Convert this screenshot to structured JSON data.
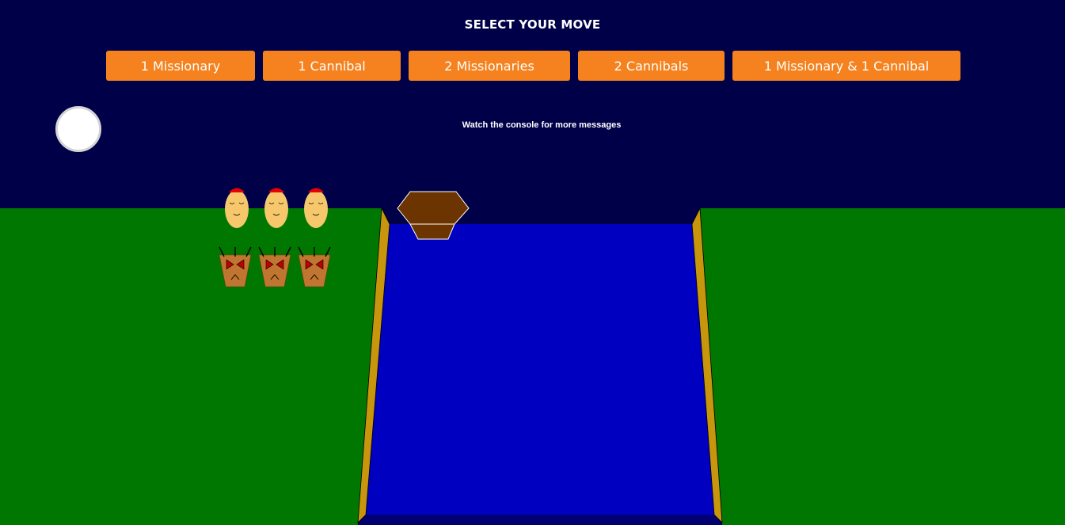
{
  "header": {
    "title": "SELECT YOUR MOVE",
    "buttons": [
      {
        "label": "1 Missionary"
      },
      {
        "label": "1 Cannibal"
      },
      {
        "label": "2 Missionaries"
      },
      {
        "label": "2 Cannibals"
      },
      {
        "label": "1 Missionary & 1 Cannibal"
      }
    ]
  },
  "console_message": "Watch the console for more messages",
  "game_state": {
    "left_bank": {
      "missionaries": 3,
      "cannibals": 3
    },
    "right_bank": {
      "missionaries": 0,
      "cannibals": 0
    },
    "boat_side": "left"
  },
  "colors": {
    "sky": "#000048",
    "button": "#f5821f",
    "grass": "#007700",
    "river": "#0000c0",
    "bank_edge": "#c8960c",
    "boat": "#6b3400",
    "missionary_face": "#f7c86b",
    "missionary_hat": "#e80000",
    "cannibal_body": "#c07630",
    "cannibal_eyes": "#c00000"
  },
  "icons": {
    "moon": "moon-icon",
    "boat": "boat-icon",
    "missionary": "missionary-icon",
    "cannibal": "cannibal-icon"
  }
}
